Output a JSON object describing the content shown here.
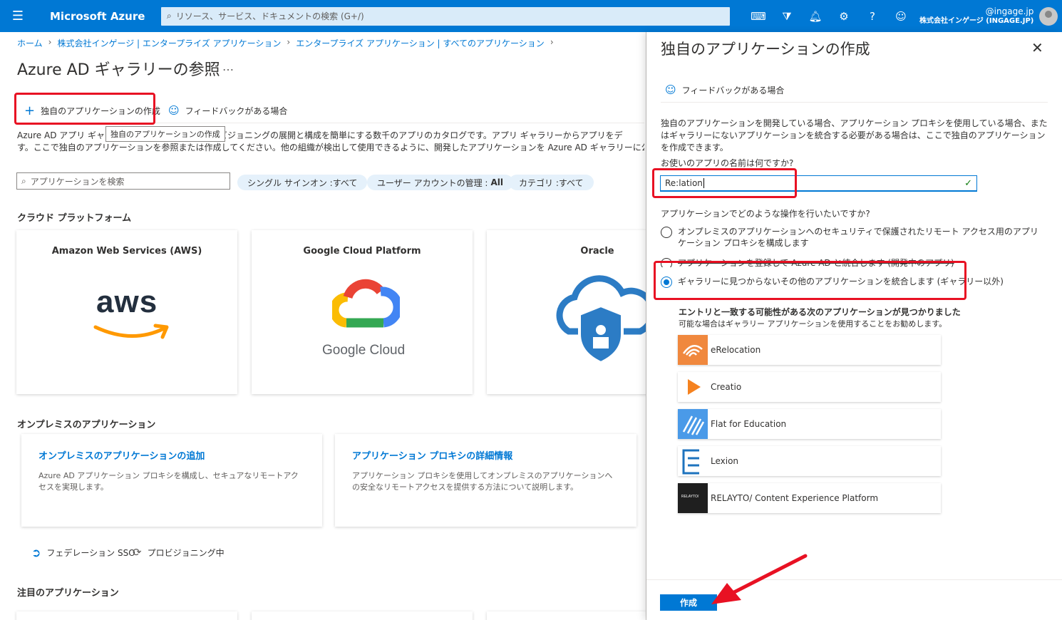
{
  "topbar": {
    "brand": "Microsoft Azure",
    "search_placeholder": "リソース、サービス、ドキュメントの検索 (G+/)",
    "account_user": "@ingage.jp",
    "account_tenant": "株式会社インゲージ (INGAGE.JP)",
    "icons": [
      "cloud-shell-icon",
      "directory-filter-icon",
      "notifications-icon",
      "settings-icon",
      "help-icon",
      "feedback-icon"
    ]
  },
  "breadcrumb": [
    "ホーム",
    "株式会社インゲージ | エンタープライズ アプリケーション",
    "エンタープライズ アプリケーション | すべてのアプリケーション"
  ],
  "page": {
    "title": "Azure AD ギャラリーの参照",
    "more": "…",
    "cmd_create": "独自のアプリケーションの作成",
    "cmd_feedback": "フィードバックがある場合",
    "tooltip": "独自のアプリケーションの作成",
    "desc_line1": "Azure AD アプリ ギャラリー                              ) と自動ユーザー プロビジョニングの展開と構成を簡単にする数千のアプリのカタログです。アプリ ギャラリーからアプリをデ",
    "desc_line2": "す。ここで独自のアプリケーションを参照または作成してください。他の組織が検出して使用できるように、開発したアプリケーションを Azure AD ギャラリーに公開する場合は、次に説",
    "search_placeholder": "アプリケーションを検索",
    "filters": [
      {
        "label": "シングル サインオン : ",
        "value": "すべて"
      },
      {
        "label": "ユーザー アカウントの管理 : ",
        "value": "All"
      },
      {
        "label": "カテゴリ : ",
        "value": "すべて"
      }
    ],
    "cloud_heading": "クラウド プラットフォーム",
    "cloud_cards": [
      "Amazon Web Services (AWS)",
      "Google Cloud Platform",
      "Oracle"
    ],
    "aws_logo_text": "aws",
    "gcp_logo_text": "Google Cloud",
    "onprem_heading": "オンプレミスのアプリケーション",
    "onprem_cards": [
      {
        "title": "オンプレミスのアプリケーションの追加",
        "desc": "Azure AD アプリケーション プロキシを構成し、セキュアなリモートアクセスを実現します。"
      },
      {
        "title": "アプリケーション プロキシの詳細情報",
        "desc": "アプリケーション プロキシを使用してオンプレミスのアプリケーションへの安全なリモートアクセスを提供する方法について説明します。"
      }
    ],
    "link_federation": "フェデレーション SSO",
    "link_provisioning": "プロビジョニング中",
    "featured_heading": "注目のアプリケーション"
  },
  "panel": {
    "title": "独自のアプリケーションの作成",
    "feedback": "フィードバックがある場合",
    "desc": "独自のアプリケーションを開発している場合、アプリケーション プロキシを使用している場合、またはギャラリーにないアプリケーションを統合する必要がある場合は、ここで独自のアプリケーションを作成できます。",
    "name_question": "お使いのアプリの名前は何ですか?",
    "name_value": "Re:lation",
    "action_question": "アプリケーションでどのような操作を行いたいですか?",
    "options": [
      {
        "label": "オンプレミスのアプリケーションへのセキュリティで保護されたリモート アクセス用のアプリケーション プロキシを構成します",
        "selected": false
      },
      {
        "label": "アプリケーションを登録して Azure AD と統合します (開発中のアプリ)",
        "selected": false
      },
      {
        "label": "ギャラリーに見つからないその他のアプリケーションを統合します (ギャラリー以外)",
        "selected": true
      }
    ],
    "match_heading": "エントリと一致する可能性がある次のアプリケーションが見つかりました",
    "match_sub": "可能な場合はギャラリー アプリケーションを使用することをお勧めします。",
    "apps": [
      "eRelocation",
      "Creatio",
      "Flat for Education",
      "Lexion",
      "RELAYTO/ Content Experience Platform"
    ],
    "relayto_logo_text": "RELAYTO/",
    "create_button": "作成"
  },
  "colors": {
    "azure_blue": "#0078d4",
    "highlight_red": "#e81123"
  }
}
